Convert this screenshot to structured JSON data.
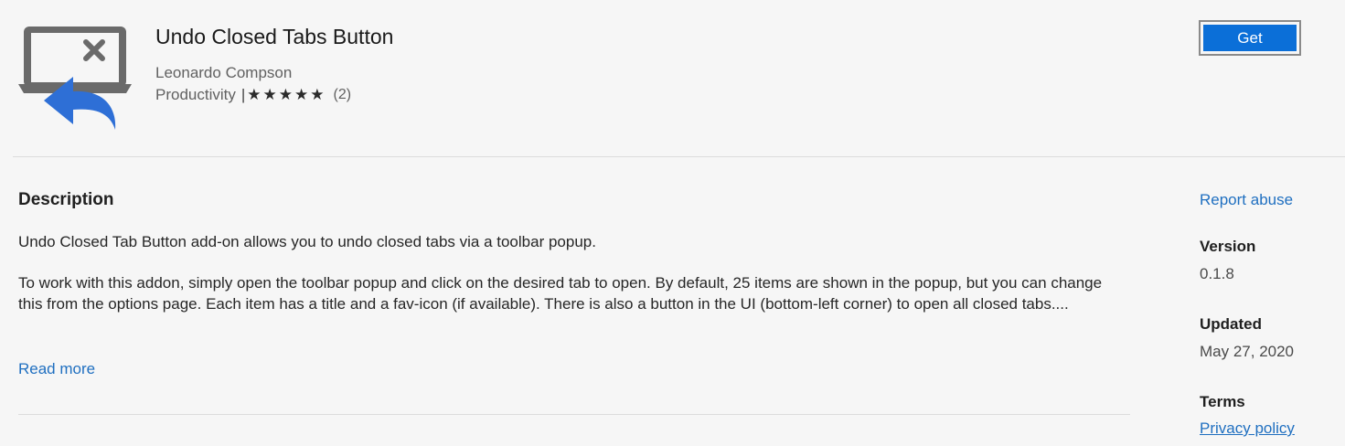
{
  "app": {
    "title": "Undo Closed Tabs Button",
    "author": "Leonardo Compson",
    "category": "Productivity",
    "separator": "|",
    "stars": "★★★★★",
    "rating_count": "(2)",
    "get_label": "Get",
    "icon": "undo-closed-tab-icon"
  },
  "description": {
    "heading": "Description",
    "paragraph1": "Undo Closed Tab Button add-on allows you to undo closed tabs via a toolbar popup.",
    "paragraph2": "To work with this addon, simply open the toolbar popup and click on the desired tab to open. By default, 25 items are shown in the popup, but you can change this from the options page. Each item has a title and a fav-icon (if available). There is also a button in the UI (bottom-left corner) to open all closed tabs....",
    "read_more": "Read more"
  },
  "sidebar": {
    "report_abuse": "Report abuse",
    "version_label": "Version",
    "version_value": "0.1.8",
    "updated_label": "Updated",
    "updated_value": "May 27, 2020",
    "terms_label": "Terms",
    "privacy_policy": "Privacy policy"
  },
  "colors": {
    "accent": "#0b6fd8",
    "link": "#1f6fc0",
    "background": "#f6f6f6"
  }
}
